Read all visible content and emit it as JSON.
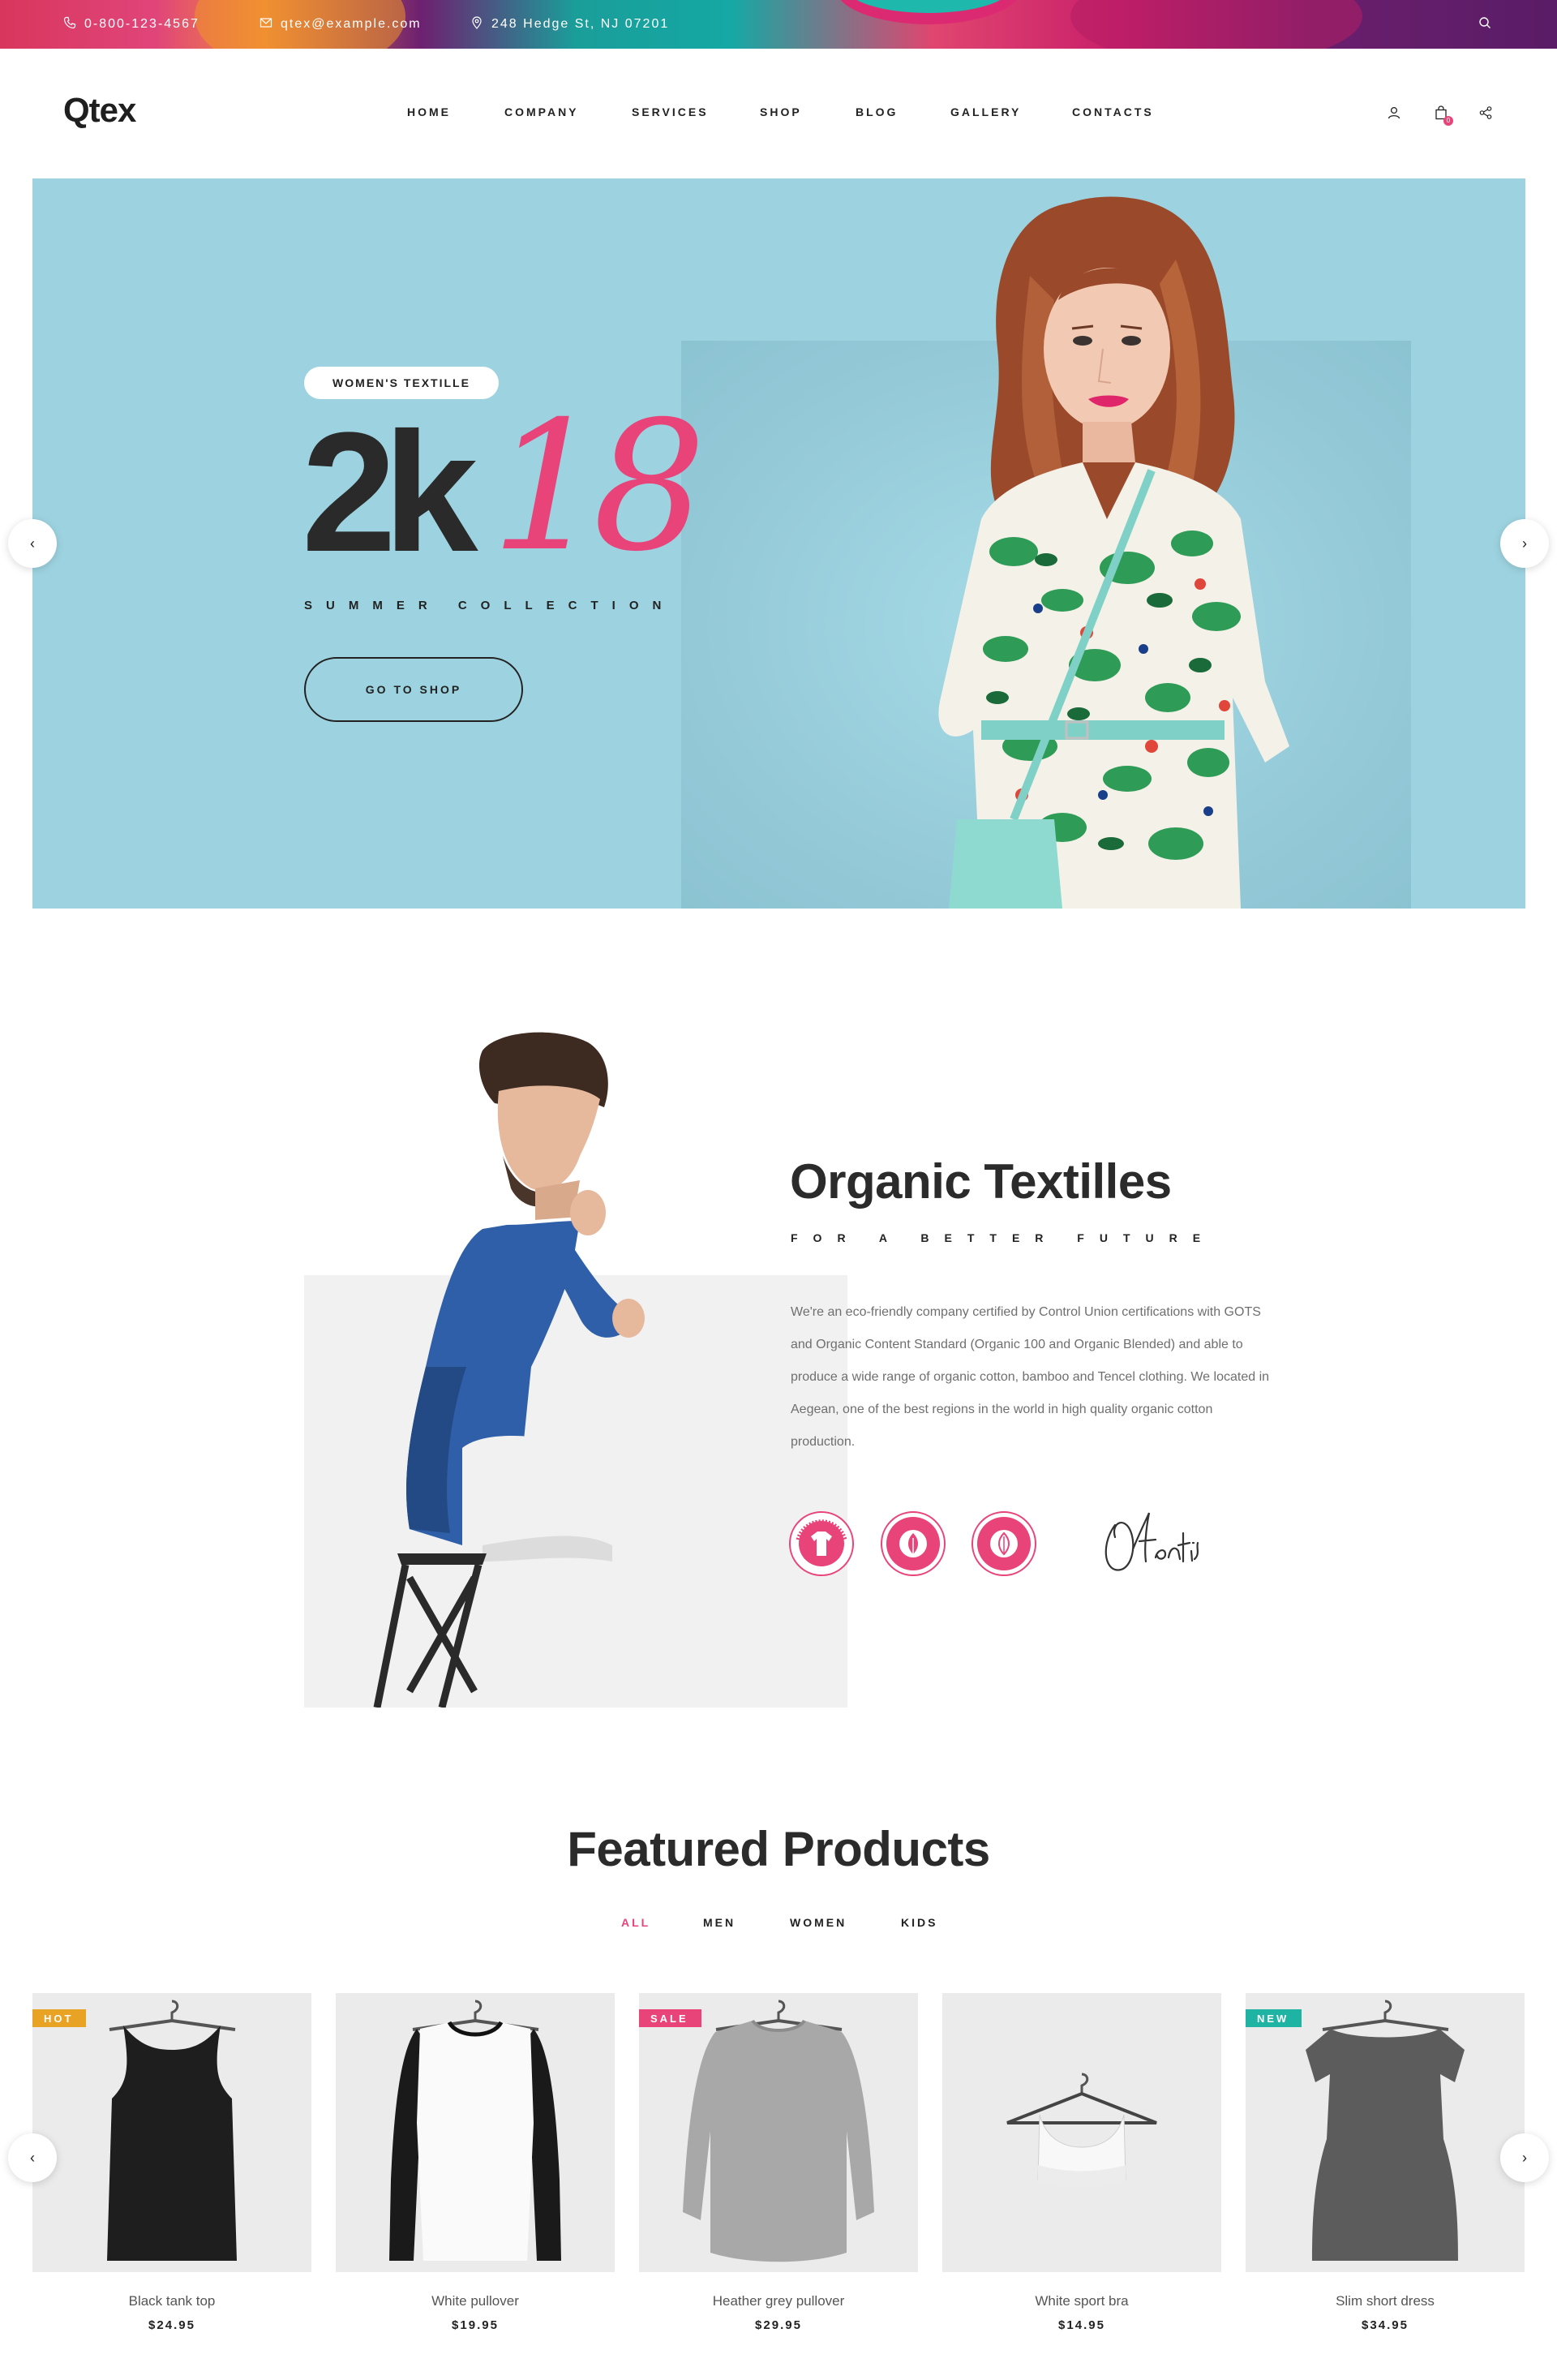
{
  "topbar": {
    "phone": "0-800-123-4567",
    "email": "qtex@example.com",
    "address": "248 Hedge St, NJ 07201"
  },
  "header": {
    "logo": "Qtex",
    "cart_count": "0",
    "nav": [
      {
        "label": "HOME"
      },
      {
        "label": "COMPANY"
      },
      {
        "label": "SERVICES"
      },
      {
        "label": "SHOP"
      },
      {
        "label": "BLOG"
      },
      {
        "label": "GALLERY"
      },
      {
        "label": "CONTACTS"
      }
    ]
  },
  "hero": {
    "badge": "WOMEN'S TEXTILLE",
    "headline_main": "2k",
    "headline_accent": "18",
    "subtitle": "SUMMER COLLECTION",
    "button": "GO TO SHOP",
    "prev_arrow": "‹",
    "next_arrow": "›"
  },
  "about": {
    "title": "Organic Textilles",
    "subtitle": "FOR A BETTER FUTURE",
    "text": "We're an eco-friendly company certified by Control Union certifications with GOTS and Organic Content Standard (Organic 100 and Organic Blended) and able to produce a wide range of organic cotton, bamboo and Tencel clothing. We located in Aegean, one of the best regions in the world in high quality organic cotton production.",
    "certifications": [
      "gots-cert-icon",
      "organic-100-cert-icon",
      "organic-blended-cert-icon"
    ]
  },
  "featured": {
    "title": "Featured Products",
    "filters": [
      {
        "label": "ALL",
        "active": true
      },
      {
        "label": "MEN",
        "active": false
      },
      {
        "label": "WOMEN",
        "active": false
      },
      {
        "label": "KIDS",
        "active": false
      }
    ],
    "products": [
      {
        "name": "Black tank top",
        "price": "$24.95",
        "tag": "HOT",
        "tag_color": "#e9a324"
      },
      {
        "name": "White pullover",
        "price": "$19.95",
        "tag": "",
        "tag_color": ""
      },
      {
        "name": "Heather grey pullover",
        "price": "$29.95",
        "tag": "SALE",
        "tag_color": "#e8447a"
      },
      {
        "name": "White sport bra",
        "price": "$14.95",
        "tag": "",
        "tag_color": ""
      },
      {
        "name": "Slim short dress",
        "price": "$34.95",
        "tag": "NEW",
        "tag_color": "#1fb3a3"
      }
    ],
    "prev_arrow": "‹",
    "next_arrow": "›"
  },
  "colors": {
    "accent": "#e8447a",
    "hero_bg": "#9dd3e0",
    "text_dark": "#222222"
  }
}
